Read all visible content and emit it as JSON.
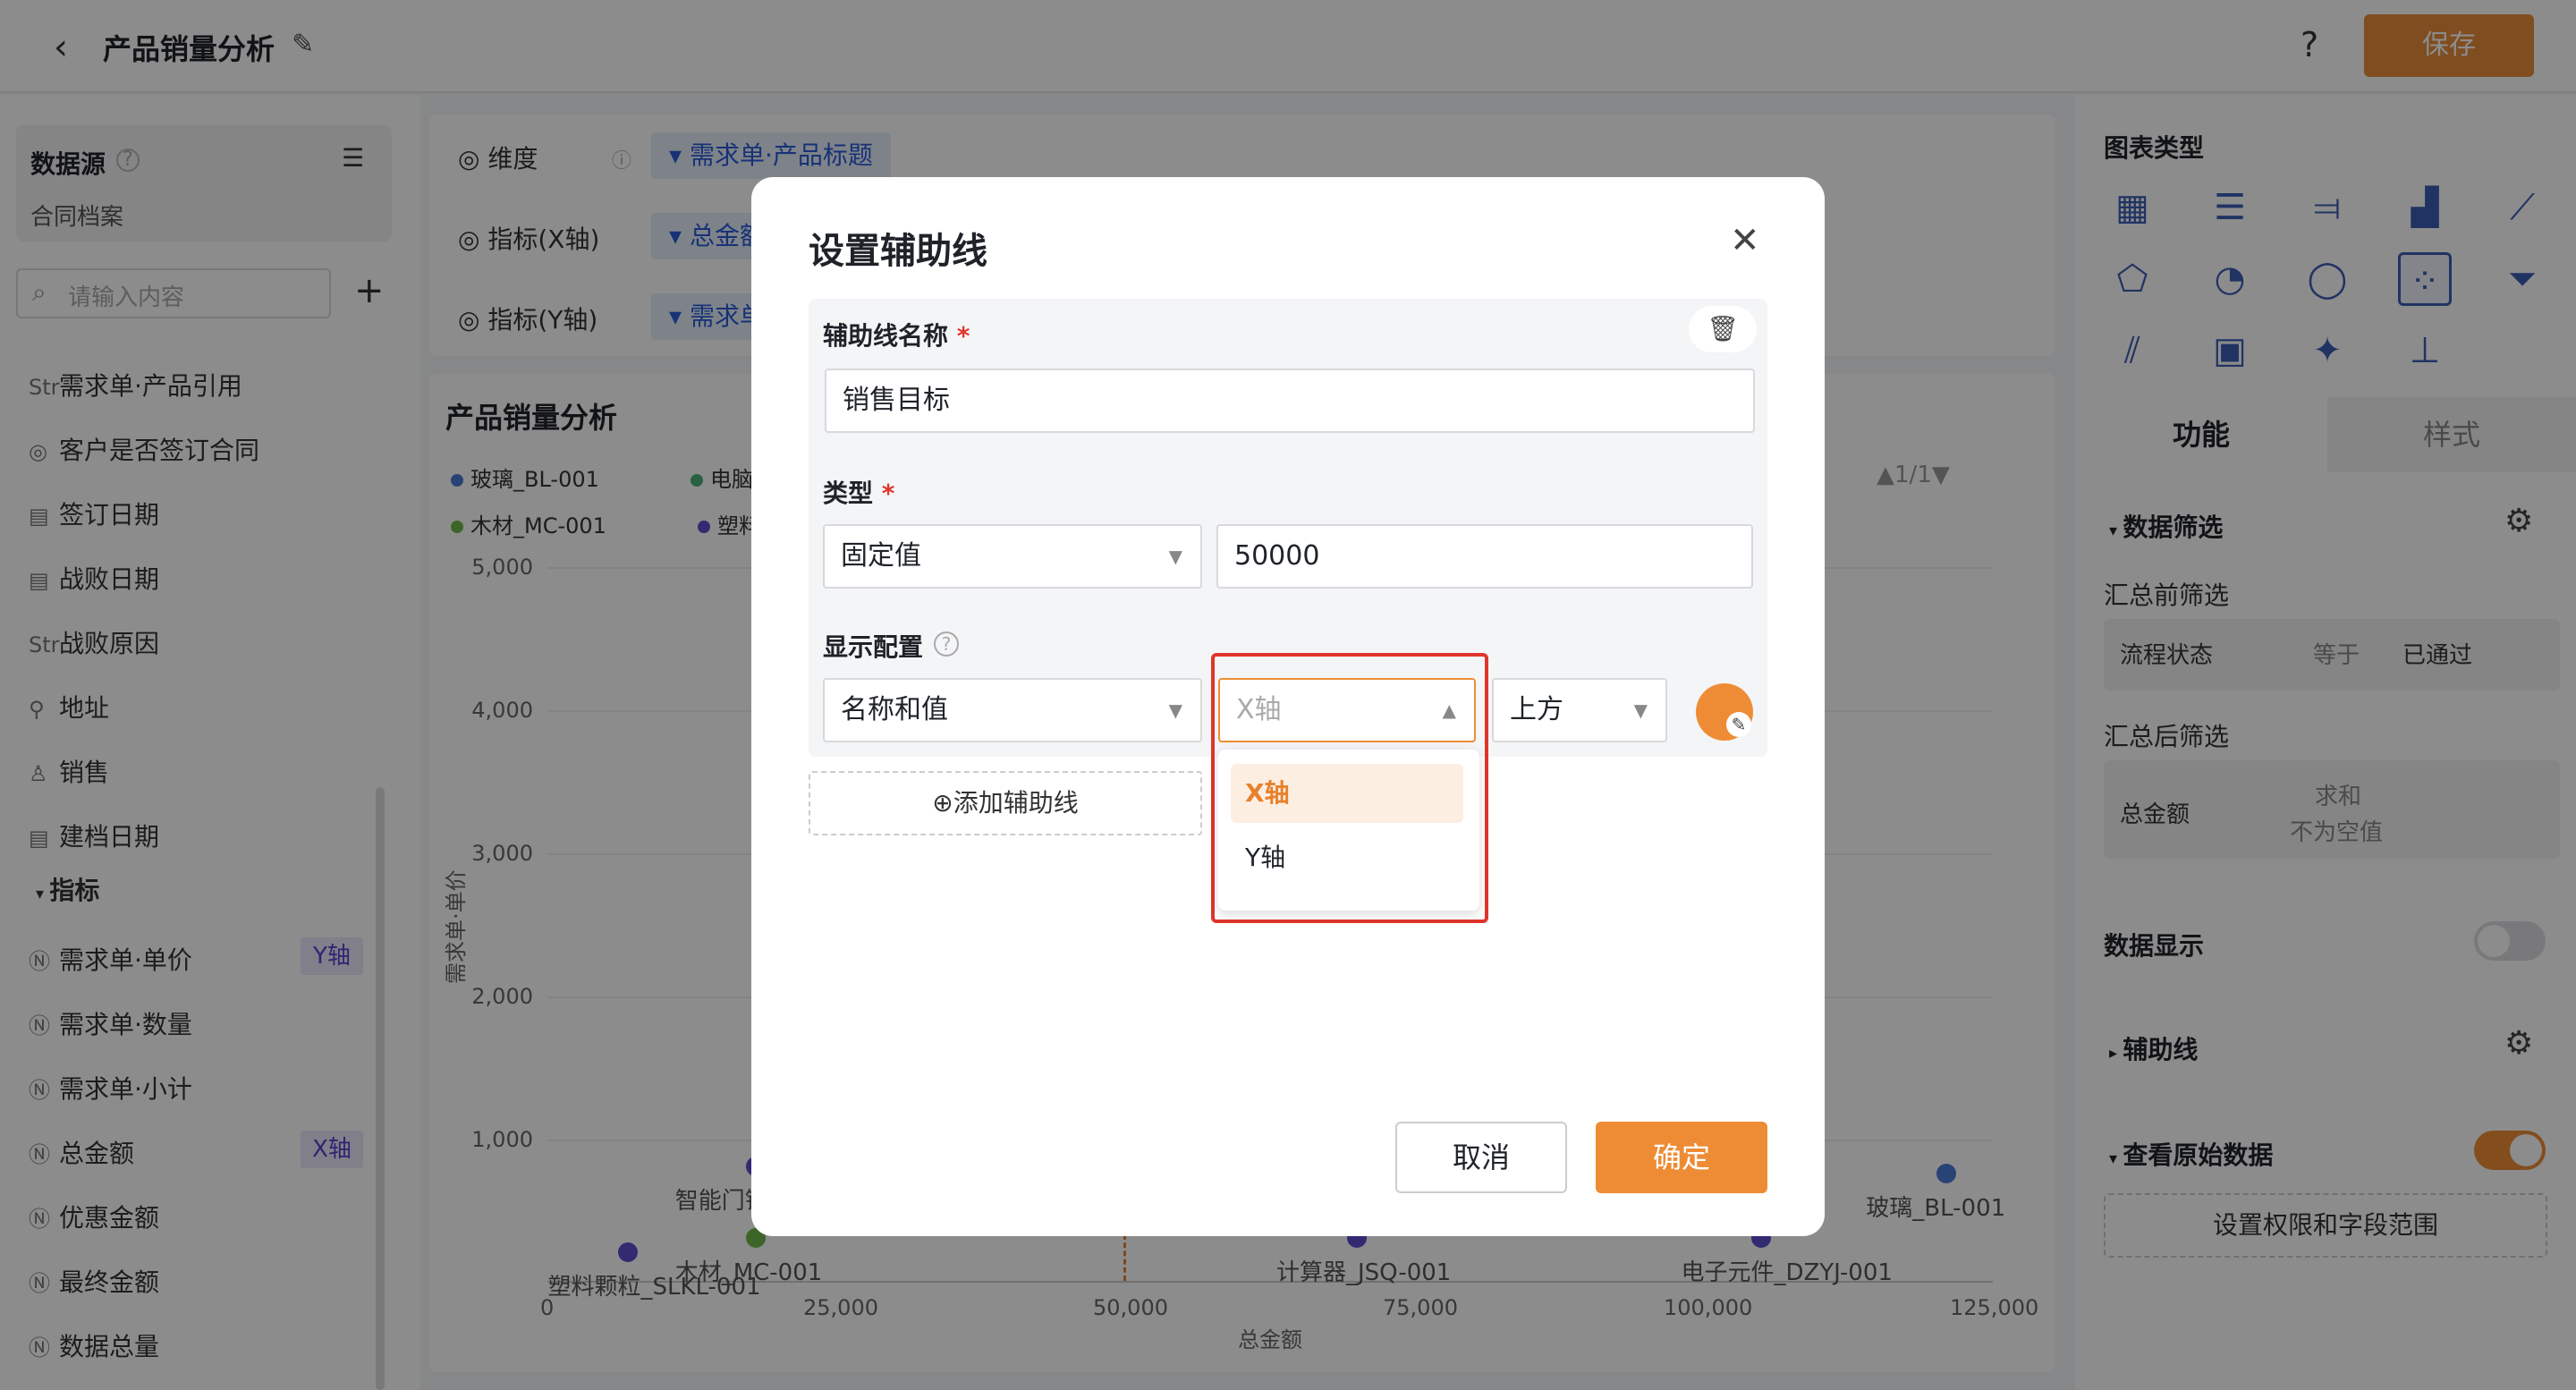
{
  "header": {
    "title": "产品销量分析",
    "save_label": "保存",
    "help": "?"
  },
  "left": {
    "datasource_title": "数据源",
    "datasource_name": "合同档案",
    "search_placeholder": "请输入内容",
    "fields": [
      {
        "type": "Str",
        "label": "需求单·产品引用"
      },
      {
        "type": "◎",
        "label": "客户是否签订合同"
      },
      {
        "type": "▤",
        "label": "签订日期"
      },
      {
        "type": "▤",
        "label": "战败日期"
      },
      {
        "type": "Str",
        "label": "战败原因"
      },
      {
        "type": "⚲",
        "label": "地址"
      },
      {
        "type": "♙",
        "label": "销售"
      },
      {
        "type": "▤",
        "label": "建档日期"
      }
    ],
    "metrics_header": "指标",
    "metrics": [
      {
        "label": "需求单·单价",
        "tag": "Y轴"
      },
      {
        "label": "需求单·数量",
        "tag": ""
      },
      {
        "label": "需求单·小计",
        "tag": ""
      },
      {
        "label": "总金额",
        "tag": "X轴"
      },
      {
        "label": "优惠金额",
        "tag": ""
      },
      {
        "label": "最终金额",
        "tag": ""
      },
      {
        "label": "数据总量",
        "tag": ""
      }
    ]
  },
  "shelf": {
    "rows": [
      {
        "label": "维度",
        "pill": "需求单·产品标题"
      },
      {
        "label": "指标(X轴)",
        "pill": "总金额"
      },
      {
        "label": "指标(Y轴)",
        "pill": "需求单"
      }
    ]
  },
  "chart_data": {
    "type": "scatter",
    "title": "产品销量分析",
    "xlabel": "总金额",
    "ylabel": "需求单·单价",
    "xlim": [
      0,
      125000
    ],
    "ylim": [
      0,
      5000
    ],
    "x_ticks": [
      "0",
      "25,000",
      "50,000",
      "75,000",
      "100,000",
      "125,000"
    ],
    "y_ticks": [
      "1,000",
      "2,000",
      "3,000",
      "4,000",
      "5,000"
    ],
    "legend": [
      {
        "name": "玻璃_BL-001",
        "color": "#4a7bd6"
      },
      {
        "name": "电脑",
        "color": "#4caf7a"
      },
      {
        "name": "木材_MC-001",
        "color": "#6fb84a"
      },
      {
        "name": "塑料",
        "color": "#5b4fcf"
      }
    ],
    "pager": "1/1",
    "points": [
      {
        "label": "塑料颗粒_SLKL-001",
        "x": 7000,
        "y": 200,
        "color": "#5b4fcf"
      },
      {
        "label": "木材_MC-001",
        "x": 18000,
        "y": 300,
        "color": "#6fb84a"
      },
      {
        "label": "智能门锁",
        "x": 18000,
        "y": 800,
        "color": "#5b4fcf"
      },
      {
        "label": "计算器_JSQ-001",
        "x": 70000,
        "y": 300,
        "color": "#5b4fcf"
      },
      {
        "label": "电子元件_DZYJ-001",
        "x": 105000,
        "y": 300,
        "color": "#5b4fcf"
      },
      {
        "label": "玻璃_BL-001",
        "x": 121000,
        "y": 750,
        "color": "#4a7bd6"
      }
    ]
  },
  "right": {
    "chart_types_title": "图表类型",
    "chart_type_icons": [
      "table-icon",
      "list-icon",
      "bar-horizontal-icon",
      "bar-icon",
      "line-icon",
      "radar-icon",
      "pie-icon",
      "donut-icon",
      "scatter-icon",
      "funnel-icon",
      "combo-icon",
      "number-card-icon",
      "map-icon",
      "tree-icon"
    ],
    "tab_function": "功能",
    "tab_style": "样式",
    "data_filter": "数据筛选",
    "pre_filter_label": "汇总前筛选",
    "pre_filter": {
      "field": "流程状态",
      "op": "等于",
      "value": "已通过"
    },
    "post_filter_label": "汇总后筛选",
    "post_filter": {
      "field": "总金额",
      "op": "求和",
      "cond": "不为空值"
    },
    "data_display": "数据显示",
    "aux_line": "辅助线",
    "view_raw": "查看原始数据",
    "perm_button": "设置权限和字段范围"
  },
  "modal": {
    "title": "设置辅助线",
    "name_label": "辅助线名称",
    "name_value": "销售目标",
    "type_label": "类型",
    "type_value": "固定值",
    "fixed_value": "50000",
    "display_label": "显示配置",
    "display_value": "名称和值",
    "axis_placeholder": "X轴",
    "position_value": "上方",
    "add_line": "添加辅助线",
    "axis_options": [
      "X轴",
      "Y轴"
    ],
    "cancel": "取消",
    "confirm": "确定",
    "line_color": "#ee8c35"
  }
}
